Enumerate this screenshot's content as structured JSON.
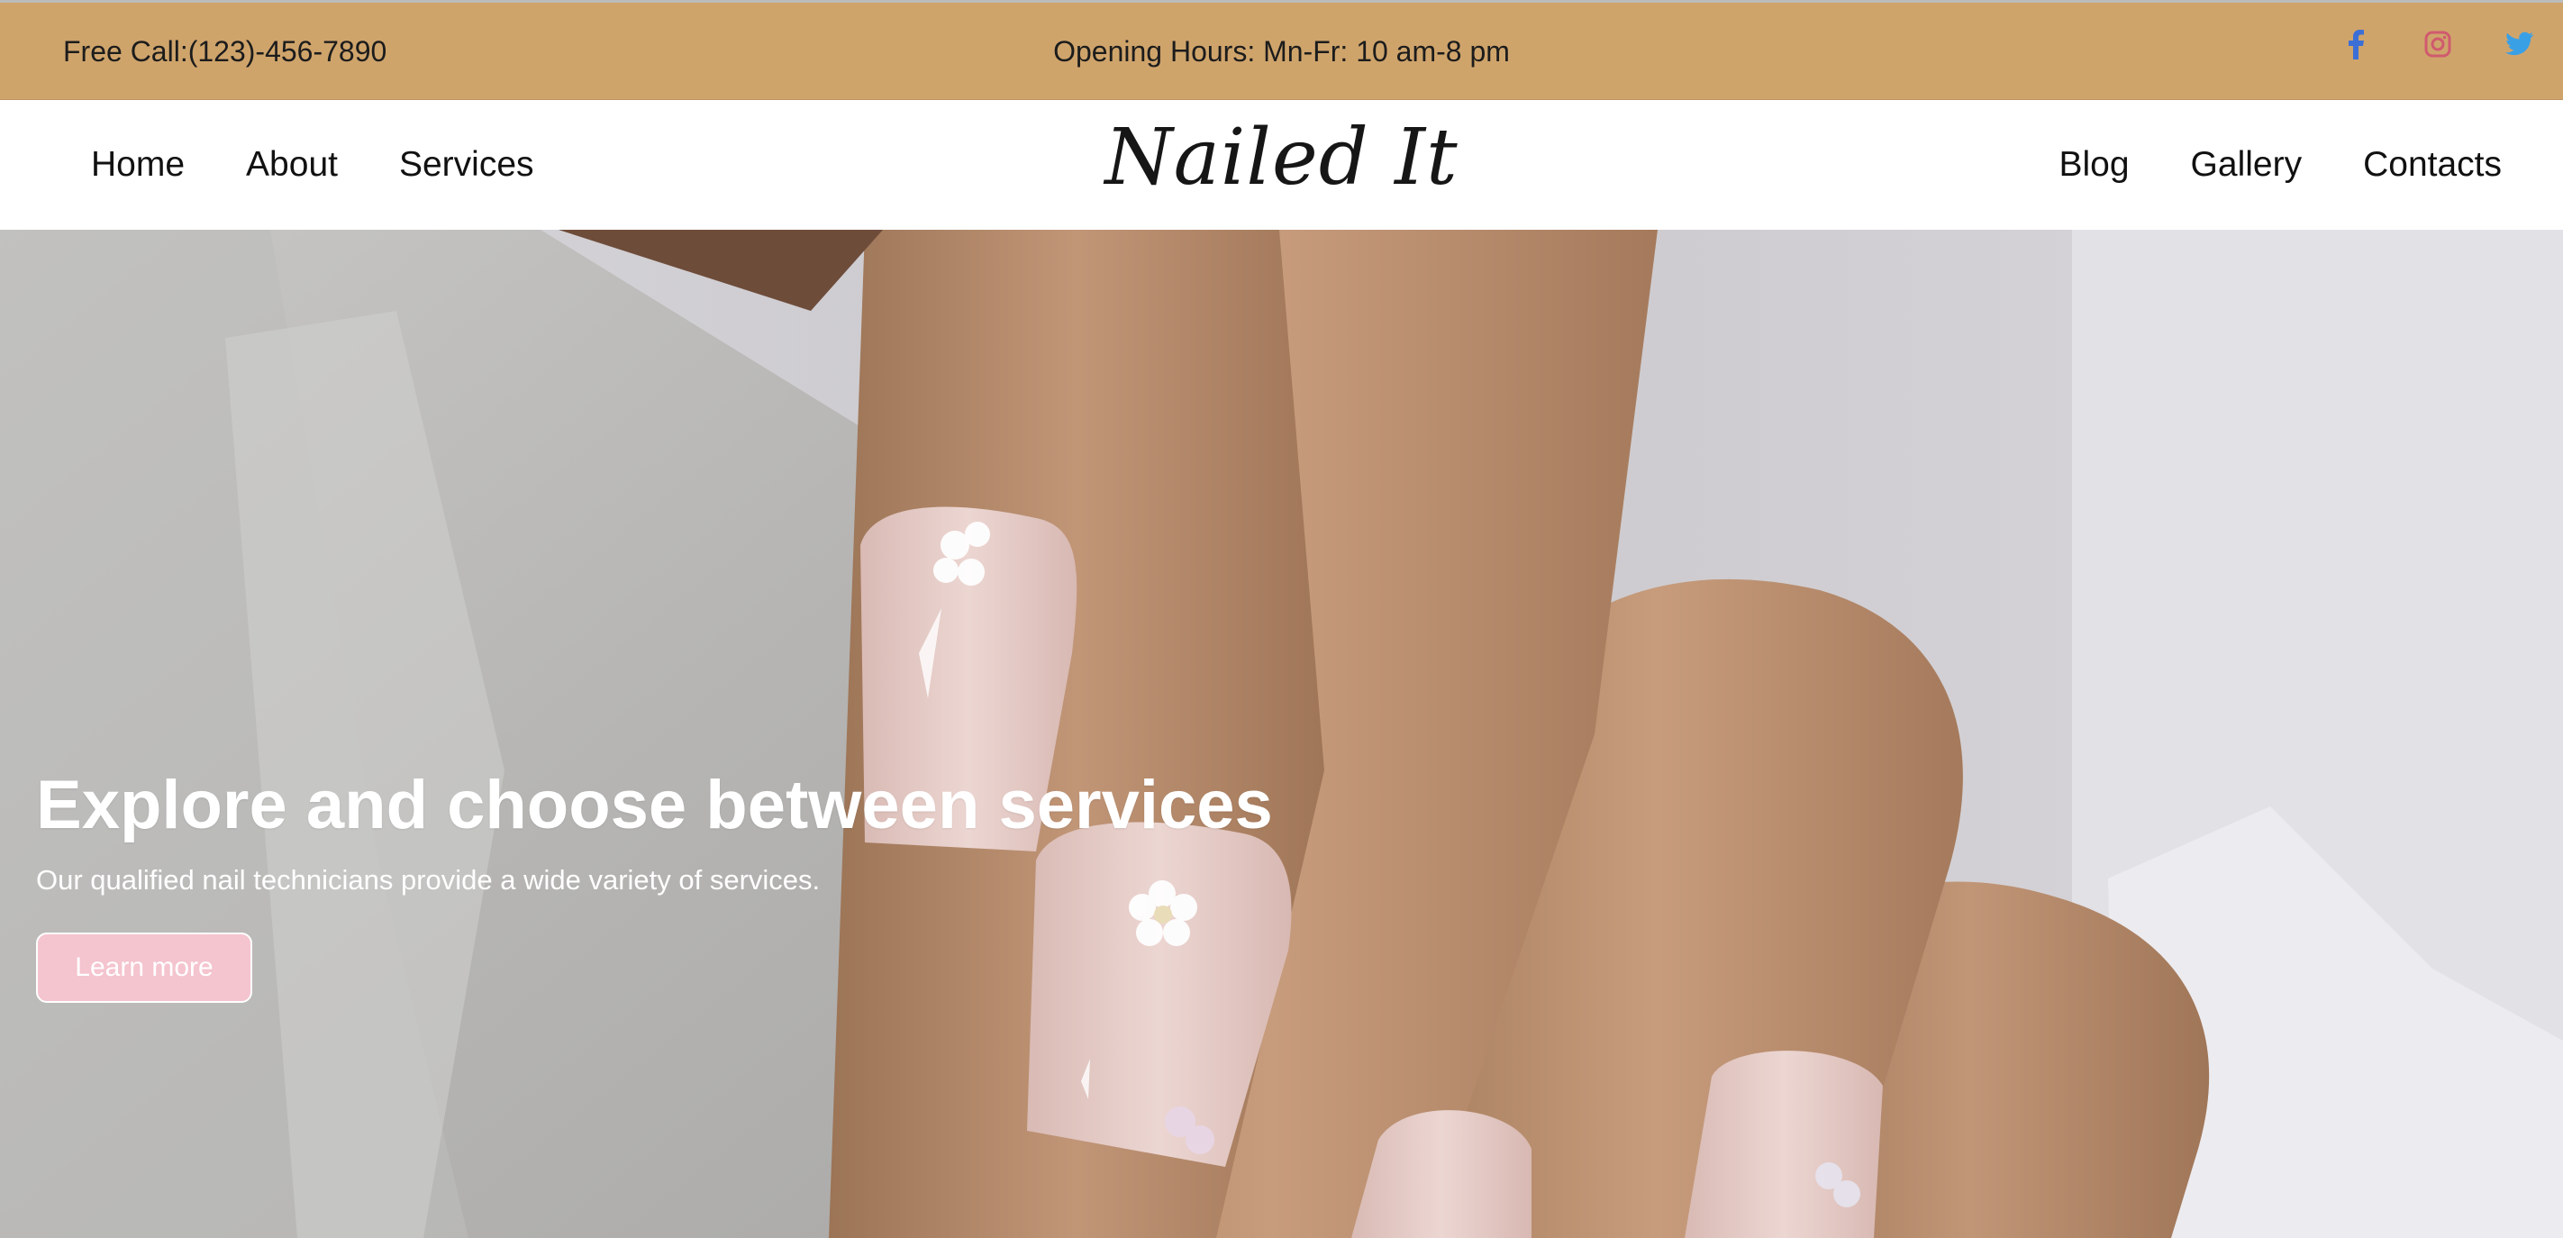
{
  "topbar": {
    "phone": "Free Call:(123)-456-7890",
    "hours": "Opening Hours: Mn-Fr: 10 am-8 pm",
    "socials": [
      {
        "name": "facebook-icon",
        "color": "#3b6fd6"
      },
      {
        "name": "instagram-icon",
        "color": "#d05a6e"
      },
      {
        "name": "twitter-icon",
        "color": "#3aa0e6"
      }
    ],
    "background": "#cfa46b"
  },
  "nav": {
    "left": [
      "Home",
      "About",
      "Services"
    ],
    "right": [
      "Blog",
      "Gallery",
      "Contacts"
    ],
    "logo": "Nailed It"
  },
  "hero": {
    "title": "Explore and choose between services",
    "subtitle": "Our qualified nail technicians provide a wide variety of services.",
    "button_label": "Learn more",
    "button_color": "#f4c4cf"
  }
}
